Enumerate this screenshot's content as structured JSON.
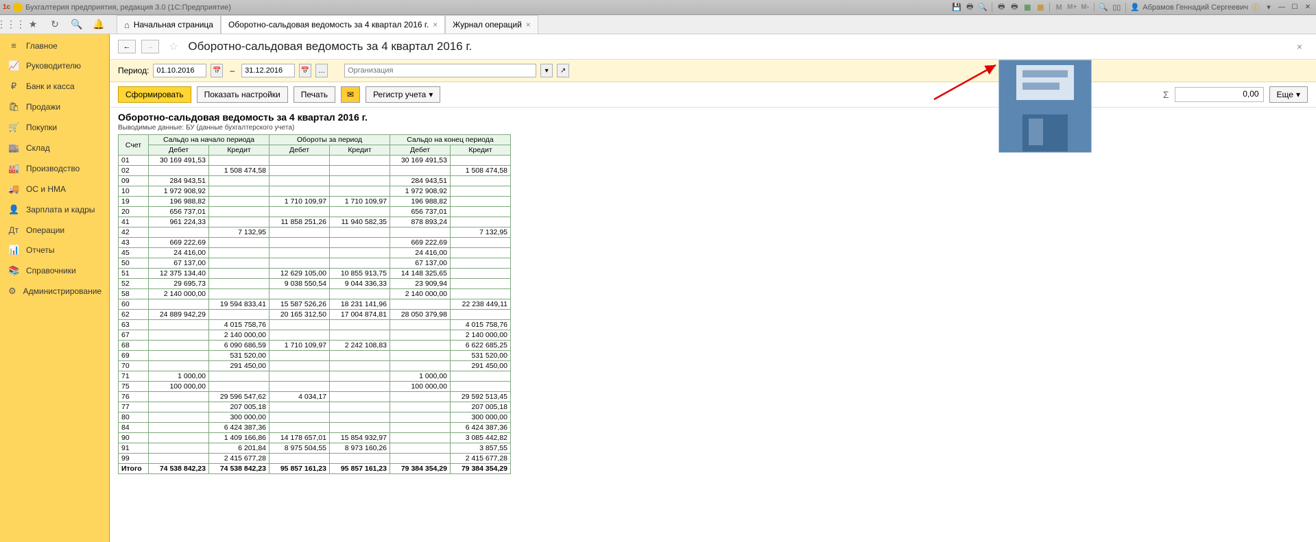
{
  "titlebar": {
    "app": "Бухгалтерия предприятия, редакция 3.0  (1С:Предприятие)",
    "user": "Абрамов Геннадий Сергеевич",
    "m_labels": [
      "M",
      "M+",
      "M-"
    ]
  },
  "tabs": {
    "home": "Начальная страница",
    "t1": "Оборотно-сальдовая ведомость за 4 квартал 2016 г.",
    "t2": "Журнал операций"
  },
  "sidebar": {
    "items": [
      {
        "icon": "≡",
        "label": "Главное"
      },
      {
        "icon": "📈",
        "label": "Руководителю"
      },
      {
        "icon": "₽",
        "label": "Банк и касса"
      },
      {
        "icon": "🛍",
        "label": "Продажи"
      },
      {
        "icon": "🛒",
        "label": "Покупки"
      },
      {
        "icon": "🏬",
        "label": "Склад"
      },
      {
        "icon": "🏭",
        "label": "Производство"
      },
      {
        "icon": "🚚",
        "label": "ОС и НМА"
      },
      {
        "icon": "👤",
        "label": "Зарплата и кадры"
      },
      {
        "icon": "Дт",
        "label": "Операции"
      },
      {
        "icon": "📊",
        "label": "Отчеты"
      },
      {
        "icon": "📚",
        "label": "Справочники"
      },
      {
        "icon": "⚙",
        "label": "Администрирование"
      }
    ]
  },
  "page": {
    "title": "Оборотно-сальдовая ведомость за 4 квартал 2016 г.",
    "period_label": "Период:",
    "date_from": "01.10.2016",
    "date_to": "31.12.2016",
    "org_placeholder": "Организация"
  },
  "actions": {
    "form": "Сформировать",
    "settings": "Показать настройки",
    "print": "Печать",
    "registry": "Регистр учета",
    "more": "Еще",
    "sum_sign": "Σ",
    "sum_value": "0,00"
  },
  "report": {
    "title": "Оборотно-сальдовая ведомость за 4 квартал 2016 г.",
    "subtitle": "Выводимые данные:  БУ  (данные бухгалтерского учета)",
    "headers": {
      "account": "Счет",
      "open": "Сальдо на начало периода",
      "turnover": "Обороты за период",
      "close": "Сальдо на конец периода",
      "debit": "Дебет",
      "credit": "Кредит"
    },
    "total_label": "Итого"
  },
  "chart_data": {
    "type": "table",
    "columns": [
      "Счет",
      "Сальдо нач. Дебет",
      "Сальдо нач. Кредит",
      "Обороты Дебет",
      "Обороты Кредит",
      "Сальдо кон. Дебет",
      "Сальдо кон. Кредит"
    ],
    "rows": [
      [
        "01",
        "30 169 491,53",
        "",
        "",
        "",
        "30 169 491,53",
        ""
      ],
      [
        "02",
        "",
        "1 508 474,58",
        "",
        "",
        "",
        "1 508 474,58"
      ],
      [
        "09",
        "284 943,51",
        "",
        "",
        "",
        "284 943,51",
        ""
      ],
      [
        "10",
        "1 972 908,92",
        "",
        "",
        "",
        "1 972 908,92",
        ""
      ],
      [
        "19",
        "196 988,82",
        "",
        "1 710 109,97",
        "1 710 109,97",
        "196 988,82",
        ""
      ],
      [
        "20",
        "656 737,01",
        "",
        "",
        "",
        "656 737,01",
        ""
      ],
      [
        "41",
        "961 224,33",
        "",
        "11 858 251,26",
        "11 940 582,35",
        "878 893,24",
        ""
      ],
      [
        "42",
        "",
        "7 132,95",
        "",
        "",
        "",
        "7 132,95"
      ],
      [
        "43",
        "669 222,69",
        "",
        "",
        "",
        "669 222,69",
        ""
      ],
      [
        "45",
        "24 416,00",
        "",
        "",
        "",
        "24 416,00",
        ""
      ],
      [
        "50",
        "67 137,00",
        "",
        "",
        "",
        "67 137,00",
        ""
      ],
      [
        "51",
        "12 375 134,40",
        "",
        "12 629 105,00",
        "10 855 913,75",
        "14 148 325,65",
        ""
      ],
      [
        "52",
        "29 695,73",
        "",
        "9 038 550,54",
        "9 044 336,33",
        "23 909,94",
        ""
      ],
      [
        "58",
        "2 140 000,00",
        "",
        "",
        "",
        "2 140 000,00",
        ""
      ],
      [
        "60",
        "",
        "19 594 833,41",
        "15 587 526,26",
        "18 231 141,96",
        "",
        "22 238 449,11"
      ],
      [
        "62",
        "24 889 942,29",
        "",
        "20 165 312,50",
        "17 004 874,81",
        "28 050 379,98",
        ""
      ],
      [
        "63",
        "",
        "4 015 758,76",
        "",
        "",
        "",
        "4 015 758,76"
      ],
      [
        "67",
        "",
        "2 140 000,00",
        "",
        "",
        "",
        "2 140 000,00"
      ],
      [
        "68",
        "",
        "6 090 686,59",
        "1 710 109,97",
        "2 242 108,83",
        "",
        "6 622 685,25"
      ],
      [
        "69",
        "",
        "531 520,00",
        "",
        "",
        "",
        "531 520,00"
      ],
      [
        "70",
        "",
        "291 450,00",
        "",
        "",
        "",
        "291 450,00"
      ],
      [
        "71",
        "1 000,00",
        "",
        "",
        "",
        "1 000,00",
        ""
      ],
      [
        "75",
        "100 000,00",
        "",
        "",
        "",
        "100 000,00",
        ""
      ],
      [
        "76",
        "",
        "29 596 547,62",
        "4 034,17",
        "",
        "",
        "29 592 513,45"
      ],
      [
        "77",
        "",
        "207 005,18",
        "",
        "",
        "",
        "207 005,18"
      ],
      [
        "80",
        "",
        "300 000,00",
        "",
        "",
        "",
        "300 000,00"
      ],
      [
        "84",
        "",
        "6 424 387,36",
        "",
        "",
        "",
        "6 424 387,36"
      ],
      [
        "90",
        "",
        "1 409 166,86",
        "14 178 657,01",
        "15 854 932,97",
        "",
        "3 085 442,82"
      ],
      [
        "91",
        "",
        "6 201,84",
        "8 975 504,55",
        "8 973 160,26",
        "",
        "3 857,55"
      ],
      [
        "99",
        "",
        "2 415 677,28",
        "",
        "",
        "",
        "2 415 677,28"
      ]
    ],
    "total": [
      "Итого",
      "74 538 842,23",
      "74 538 842,23",
      "95 857 161,23",
      "95 857 161,23",
      "79 384 354,29",
      "79 384 354,29"
    ]
  }
}
